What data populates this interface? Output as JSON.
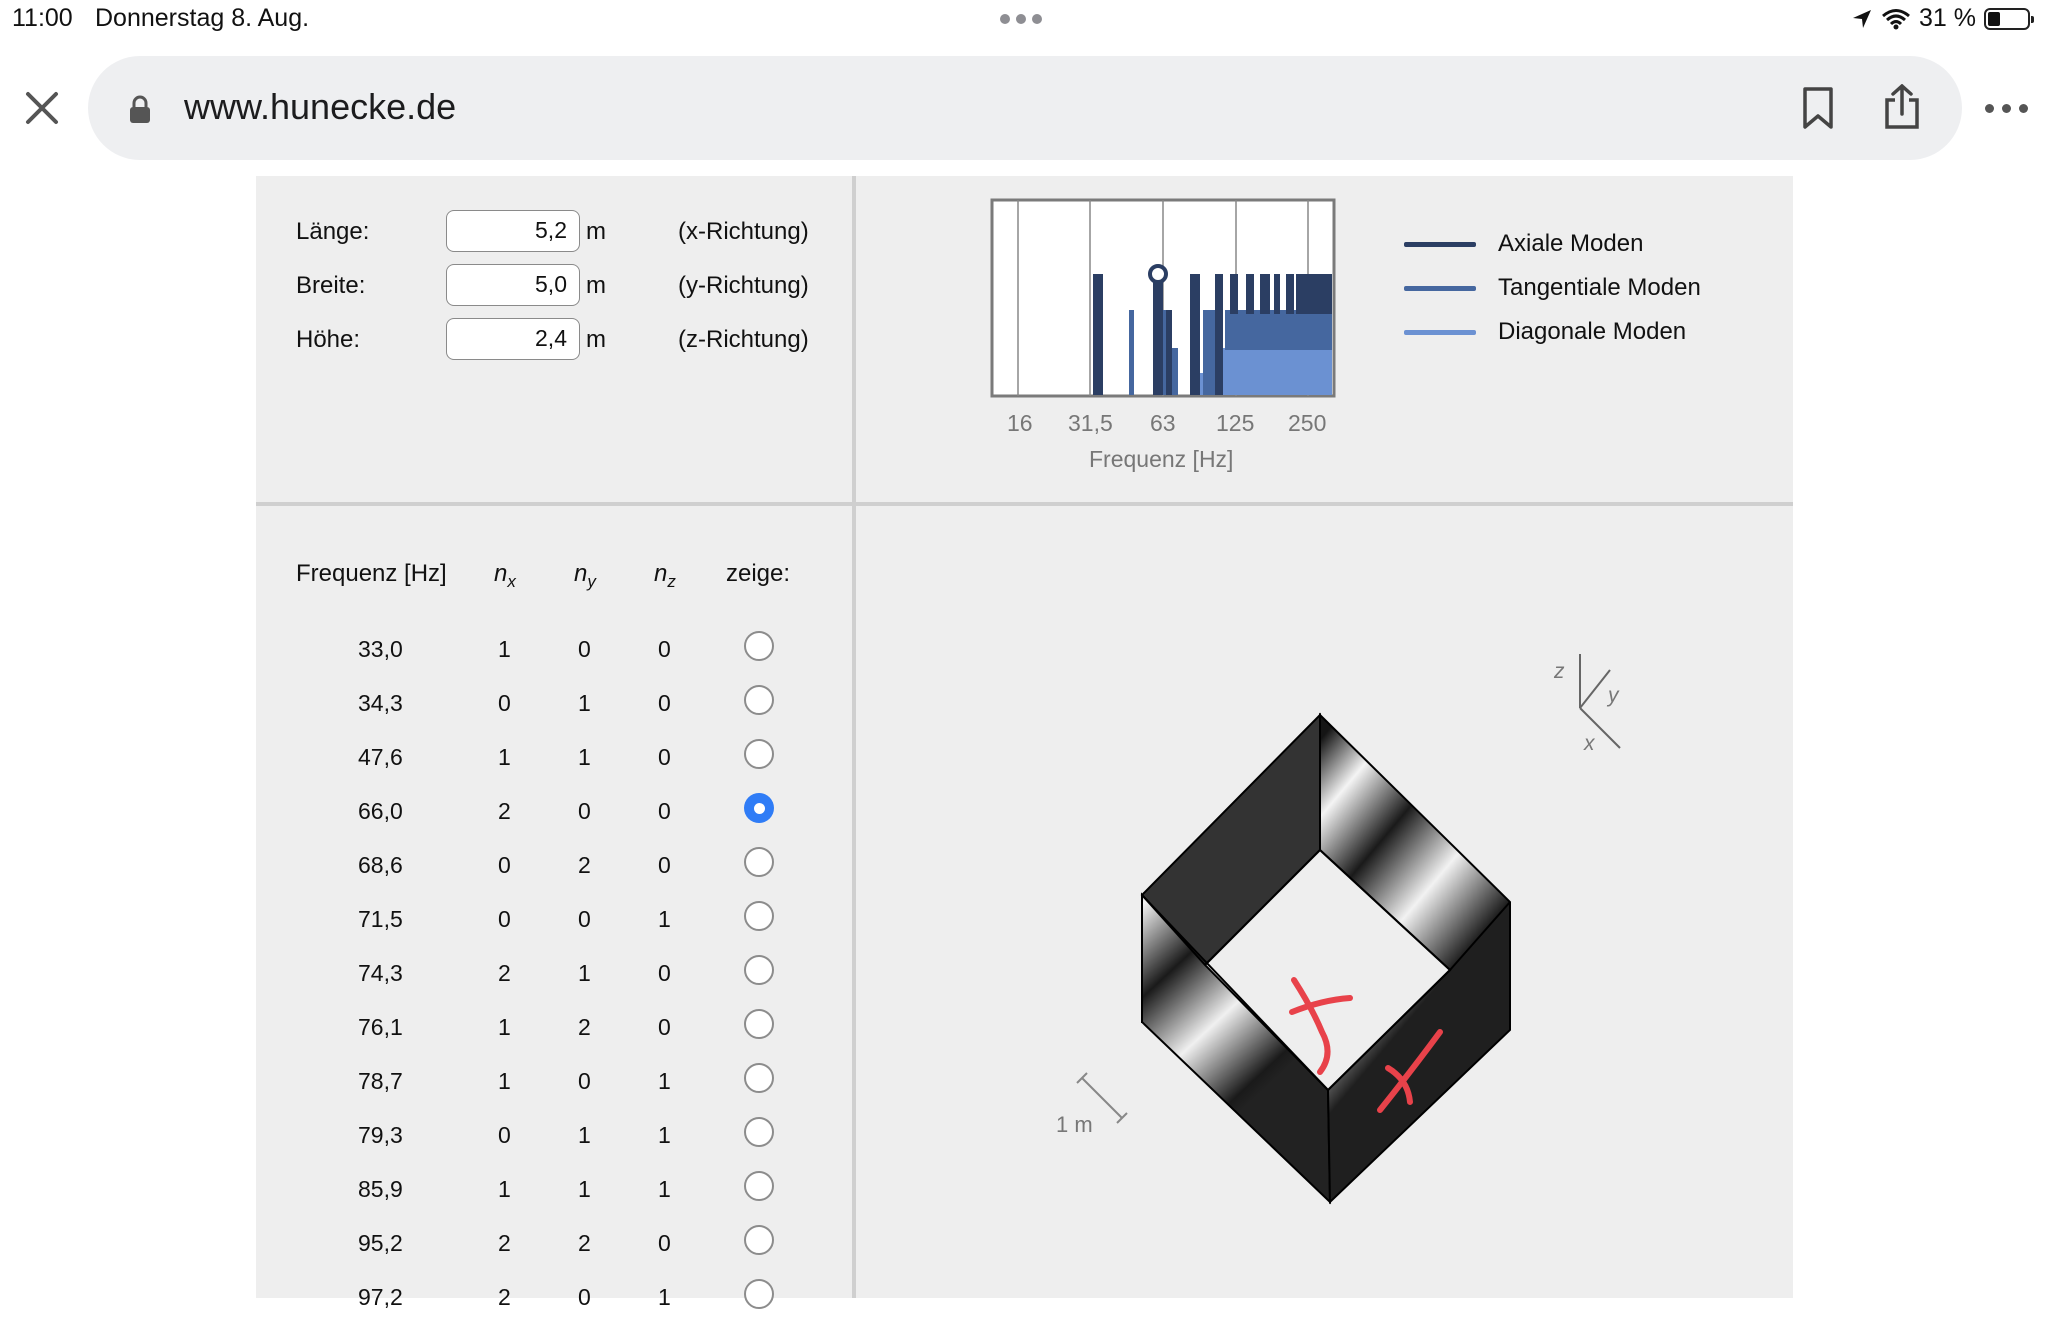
{
  "status_bar": {
    "time": "11:00",
    "date": "Donnerstag 8. Aug.",
    "battery": "31 %",
    "battery_level": 0.31
  },
  "browser": {
    "url": "www.hunecke.de",
    "close_icon": "close-icon",
    "lock_icon": "lock-icon",
    "bookmark_icon": "bookmark-icon",
    "share_icon": "share-icon",
    "more_icon": "more-icon"
  },
  "room": {
    "length": {
      "label": "Länge:",
      "value": "5,2",
      "unit": "m",
      "direction": "(x-Richtung)"
    },
    "width": {
      "label": "Breite:",
      "value": "5,0",
      "unit": "m",
      "direction": "(y-Richtung)"
    },
    "height": {
      "label": "Höhe:",
      "value": "2,4",
      "unit": "m",
      "direction": "(z-Richtung)"
    }
  },
  "spectrum": {
    "x_ticks": [
      "16",
      "31,5",
      "63",
      "125",
      "250"
    ],
    "xlabel": "Frequenz [Hz]",
    "legend": [
      {
        "label": "Axiale Moden",
        "color": "#2b3e63"
      },
      {
        "label": "Tangentiale Moden",
        "color": "#45679f"
      },
      {
        "label": "Diagonale Moden",
        "color": "#6b91d2"
      }
    ]
  },
  "modes_table": {
    "headers": {
      "freq": "Frequenz [Hz]",
      "nx": "n",
      "nx_sub": "x",
      "ny": "n",
      "ny_sub": "y",
      "nz": "n",
      "nz_sub": "z",
      "show": "zeige:"
    },
    "rows": [
      {
        "freq": "33,0",
        "nx": "1",
        "ny": "0",
        "nz": "0",
        "selected": false
      },
      {
        "freq": "34,3",
        "nx": "0",
        "ny": "1",
        "nz": "0",
        "selected": false
      },
      {
        "freq": "47,6",
        "nx": "1",
        "ny": "1",
        "nz": "0",
        "selected": false
      },
      {
        "freq": "66,0",
        "nx": "2",
        "ny": "0",
        "nz": "0",
        "selected": true
      },
      {
        "freq": "68,6",
        "nx": "0",
        "ny": "2",
        "nz": "0",
        "selected": false
      },
      {
        "freq": "71,5",
        "nx": "0",
        "ny": "0",
        "nz": "1",
        "selected": false
      },
      {
        "freq": "74,3",
        "nx": "2",
        "ny": "1",
        "nz": "0",
        "selected": false
      },
      {
        "freq": "76,1",
        "nx": "1",
        "ny": "2",
        "nz": "0",
        "selected": false
      },
      {
        "freq": "78,7",
        "nx": "1",
        "ny": "0",
        "nz": "1",
        "selected": false
      },
      {
        "freq": "79,3",
        "nx": "0",
        "ny": "1",
        "nz": "1",
        "selected": false
      },
      {
        "freq": "85,9",
        "nx": "1",
        "ny": "1",
        "nz": "1",
        "selected": false
      },
      {
        "freq": "95,2",
        "nx": "2",
        "ny": "2",
        "nz": "0",
        "selected": false
      },
      {
        "freq": "97,2",
        "nx": "2",
        "ny": "0",
        "nz": "1",
        "selected": false
      }
    ]
  },
  "visualization": {
    "axes": {
      "z": "z",
      "y": "y",
      "x": "x"
    },
    "scale_label": "1 m"
  }
}
